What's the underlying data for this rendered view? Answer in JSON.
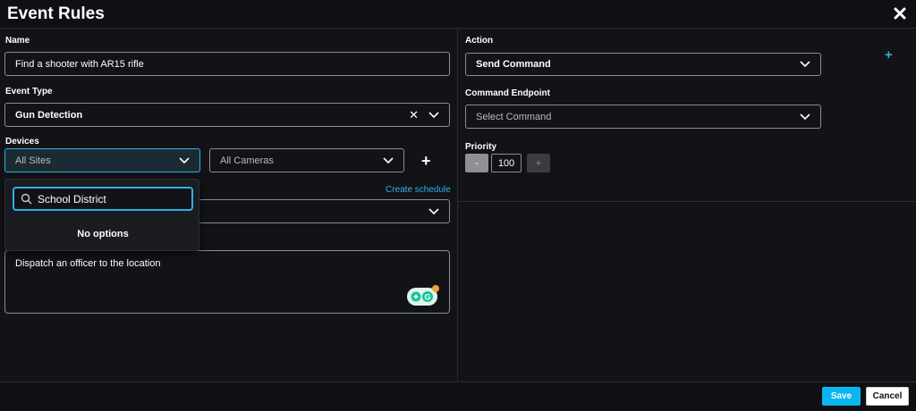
{
  "window": {
    "title": "Event Rules"
  },
  "form": {
    "name_label": "Name",
    "name_value": "Find a shooter with AR15 rifle",
    "event_type_label": "Event Type",
    "event_type_value": "Gun Detection",
    "devices_label": "Devices",
    "sites_placeholder": "All Sites",
    "cameras_placeholder": "All Cameras",
    "create_schedule_link": "Create schedule",
    "description_value": "Dispatch an officer to the location"
  },
  "site_dropdown": {
    "search_value": "School District",
    "empty_message": "No options"
  },
  "action": {
    "action_label": "Action",
    "action_value": "Send Command",
    "endpoint_label": "Command Endpoint",
    "endpoint_placeholder": "Select Command",
    "priority_label": "Priority",
    "priority_value": "100",
    "decrement_label": "-",
    "increment_label": "+"
  },
  "footer": {
    "save_label": "Save",
    "cancel_label": "Cancel"
  },
  "icons": {
    "close": "close-icon",
    "chevron": "chevron-down-icon",
    "clear": "clear-icon",
    "add": "plus-icon",
    "search": "search-icon",
    "grammarly": "grammarly-icon"
  },
  "colors": {
    "accent": "#0bb6f0",
    "link": "#33aee8",
    "background": "#121317"
  }
}
